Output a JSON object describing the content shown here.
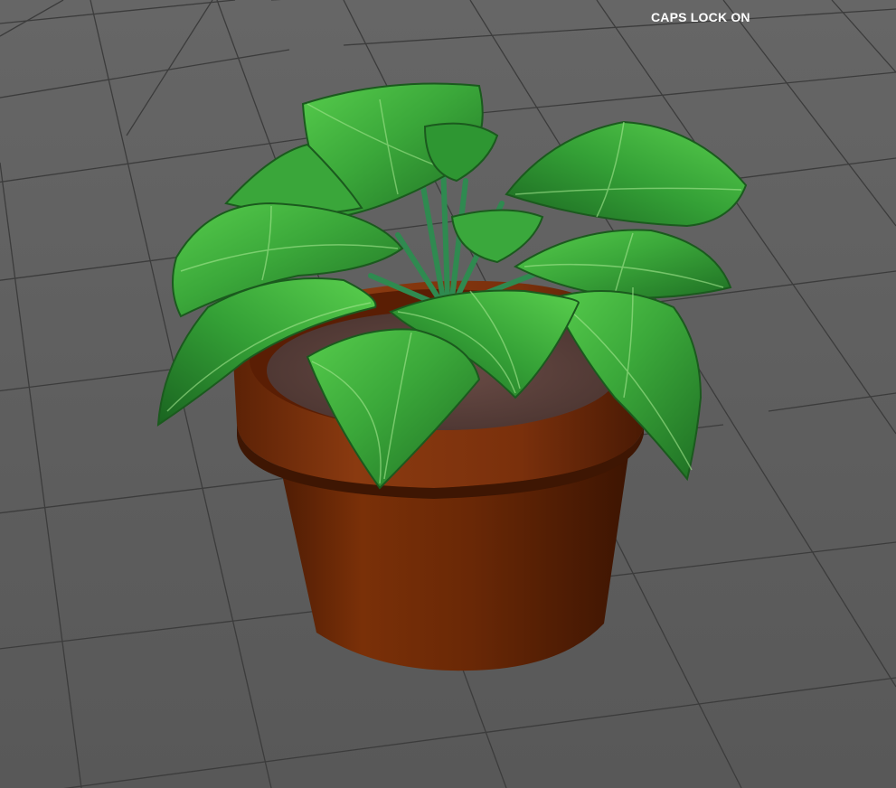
{
  "viewport": {
    "status_text": "CAPS LOCK ON"
  },
  "colors": {
    "background": "#5f5f5f",
    "grid_line": "#3a3a3a",
    "pot_base": "#6a2a08",
    "pot_rim": "#7a3410",
    "soil": "#5e4540",
    "leaf_light": "#4fc24a",
    "leaf_dark": "#1d6a1d",
    "stem": "#2f8a50",
    "status_text": "#ffffff"
  },
  "scene": {
    "object": "potted-plant-model",
    "view": "perspective-viewport-with-ground-grid"
  }
}
